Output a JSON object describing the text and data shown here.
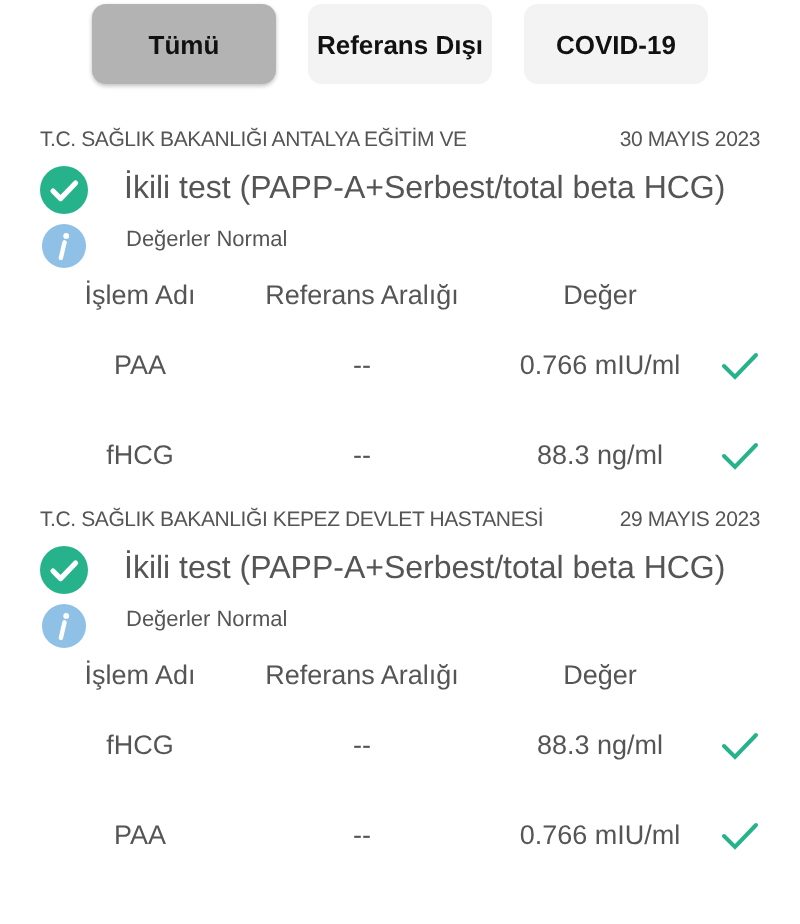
{
  "tabs": [
    {
      "label": "Tümü",
      "selected": true
    },
    {
      "label": "Referans Dışı",
      "selected": false
    },
    {
      "label": "COVID-19",
      "selected": false
    }
  ],
  "reports": [
    {
      "institution": "T.C. SAĞLIK BAKANLIĞI ANTALYA EĞİTİM VE",
      "date": "30 MAYIS 2023",
      "test": "İkili test (PAPP-A+Serbest/total beta HCG)",
      "note": "Değerler Normal",
      "columns": [
        "İşlem Adı",
        "Referans Aralığı",
        "Değer"
      ],
      "rows": [
        {
          "name": "PAA",
          "range": "--",
          "value": "0.766 mIU/ml",
          "normal": true
        },
        {
          "name": "fHCG",
          "range": "--",
          "value": "88.3 ng/ml",
          "normal": true
        }
      ]
    },
    {
      "institution": "T.C. SAĞLIK BAKANLIĞI KEPEZ DEVLET HASTANESİ",
      "date": "29 MAYIS 2023",
      "test": "İkili test (PAPP-A+Serbest/total beta HCG)",
      "note": "Değerler Normal",
      "columns": [
        "İşlem Adı",
        "Referans Aralığı",
        "Değer"
      ],
      "rows": [
        {
          "name": "fHCG",
          "range": "--",
          "value": "88.3 ng/ml",
          "normal": true
        },
        {
          "name": "PAA",
          "range": "--",
          "value": "0.766 mIU/ml",
          "normal": true
        }
      ]
    }
  ]
}
